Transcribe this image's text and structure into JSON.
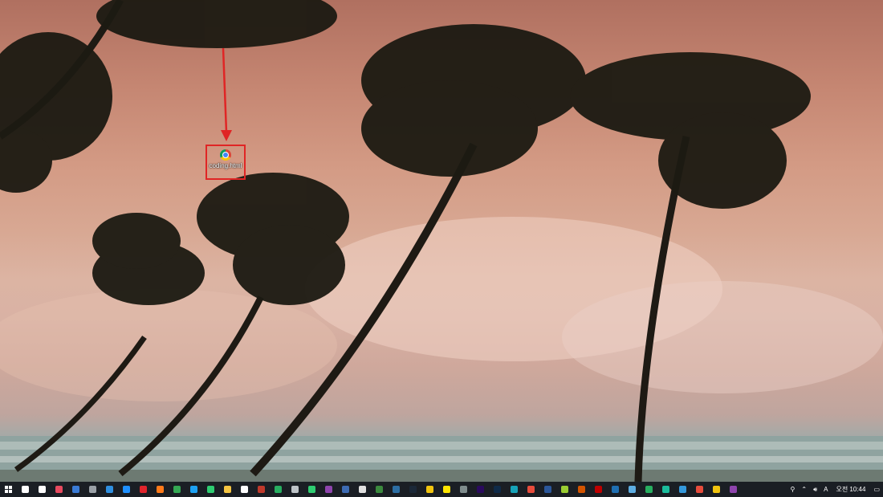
{
  "desktop": {
    "icons": [
      {
        "label": "coding.html",
        "icon": "chrome-icon"
      }
    ],
    "annotation": {
      "arrow_color": "#e02525",
      "box_color": "#e02525"
    }
  },
  "taskbar": {
    "background": "#1a1e24",
    "start": {
      "icon": "windows-logo-icon"
    },
    "pinned": [
      {
        "name": "search-icon",
        "color": "#ffffff"
      },
      {
        "name": "task-view-icon",
        "color": "#ffffff"
      },
      {
        "name": "app-red-gift-icon",
        "color": "#e84a5f"
      },
      {
        "name": "app-blue-g-icon",
        "color": "#3a7bd5"
      },
      {
        "name": "app-gray-circle-icon",
        "color": "#9aa0a6"
      },
      {
        "name": "edge-icon",
        "color": "#2f8fe0"
      },
      {
        "name": "edge-legacy-icon",
        "color": "#1e90ff"
      },
      {
        "name": "opera-icon",
        "color": "#e0242c"
      },
      {
        "name": "firefox-icon",
        "color": "#ff7a1a"
      },
      {
        "name": "chrome-icon",
        "color": "#34a853"
      },
      {
        "name": "app-bird-icon",
        "color": "#1da1f2"
      },
      {
        "name": "app-green-bubble-icon",
        "color": "#2ecc71"
      },
      {
        "name": "file-explorer-icon",
        "color": "#f5c542"
      },
      {
        "name": "store-icon",
        "color": "#ffffff"
      },
      {
        "name": "app-red-icon",
        "color": "#c0392b"
      },
      {
        "name": "app-green-icon",
        "color": "#27ae60"
      },
      {
        "name": "app-gray-icon",
        "color": "#bdc3c7"
      },
      {
        "name": "app-green-leaf-icon",
        "color": "#2ecc71"
      },
      {
        "name": "visual-studio-icon",
        "color": "#8e44ad"
      },
      {
        "name": "vs-code-blue-icon",
        "color": "#3d6bb3"
      },
      {
        "name": "app-cross-icon",
        "color": "#e0e0e0"
      },
      {
        "name": "terminal-icon",
        "color": "#3b8a3e"
      },
      {
        "name": "app-dark-blue-icon",
        "color": "#2c6ea3"
      },
      {
        "name": "steam-icon",
        "color": "#1b2838"
      },
      {
        "name": "app-yellow-circle-icon",
        "color": "#f1c40f"
      },
      {
        "name": "kakao-icon",
        "color": "#fee500"
      },
      {
        "name": "app-gray-window-icon",
        "color": "#7f8c8d"
      },
      {
        "name": "premiere-icon",
        "color": "#2a0a5e"
      },
      {
        "name": "photoshop-icon",
        "color": "#0f2a48"
      },
      {
        "name": "app-cyan-icon",
        "color": "#16a2b8"
      },
      {
        "name": "app-red-dot-icon",
        "color": "#e74c3c"
      },
      {
        "name": "word-icon",
        "color": "#2b579a"
      },
      {
        "name": "app-yellow-green-icon",
        "color": "#9acd32"
      },
      {
        "name": "app-orange-v-icon",
        "color": "#d35400"
      },
      {
        "name": "filezilla-icon",
        "color": "#bf0000"
      },
      {
        "name": "app-blue-square-icon",
        "color": "#1f6fb2"
      },
      {
        "name": "app-lightblue-icon",
        "color": "#5dade2"
      },
      {
        "name": "app-green-diamond-icon",
        "color": "#27ae60"
      },
      {
        "name": "app-green-person-icon",
        "color": "#1abc9c"
      },
      {
        "name": "app-blue-chat-icon",
        "color": "#3498db"
      },
      {
        "name": "app-red-heart-icon",
        "color": "#e74c3c"
      },
      {
        "name": "app-yellow-icon",
        "color": "#f1c40f"
      },
      {
        "name": "app-purple-icon",
        "color": "#8e44ad"
      }
    ],
    "tray": {
      "clock": "오전 10:44",
      "ime": "A"
    }
  }
}
